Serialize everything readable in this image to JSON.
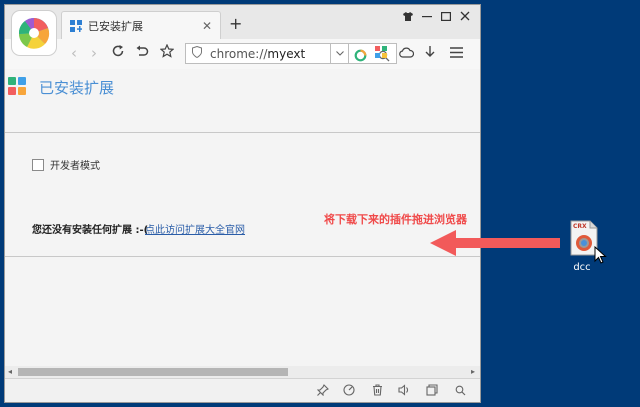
{
  "browser": {
    "tab_title": "已安装扩展",
    "new_tab_symbol": "+",
    "tab_close_symbol": "✕",
    "address_prefix": "chrome://",
    "address_bold": "myext"
  },
  "page": {
    "title": "已安装扩展",
    "developer_mode_label": "开发者模式",
    "empty_message": "您还没有安装任何扩展 :-(",
    "empty_link": "点此访问扩展大全官网"
  },
  "annotation": {
    "hint_text": "将下载下来的插件拖进浏览器",
    "color": "#f25a5a"
  },
  "desktop": {
    "file_label": "dcc",
    "file_badge": "CRX"
  },
  "colors": {
    "desktop_bg": "#003a78",
    "title_accent": "#4a8fd4",
    "link": "#2a5da8"
  }
}
